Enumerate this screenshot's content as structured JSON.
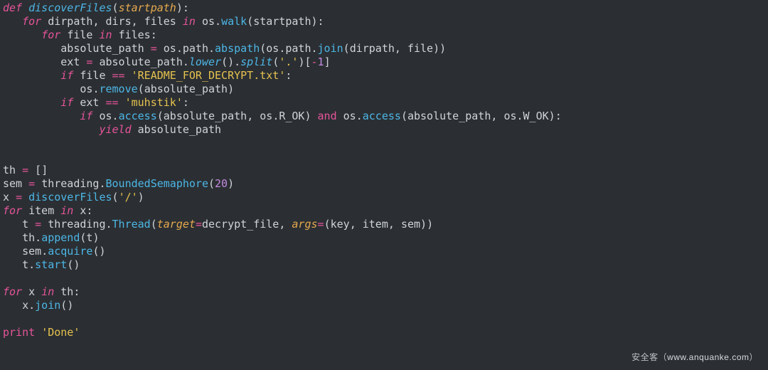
{
  "watermark": {
    "brand": "安全客",
    "site_open": "（",
    "site": "www.anquanke.com",
    "site_close": "）"
  },
  "code": {
    "kw_def": "def",
    "kw_for": "for",
    "kw_in": "in",
    "kw_if": "if",
    "kw_yield": "yield",
    "kw_and": "and",
    "kw_print": "print",
    "fn_discoverFiles": "discoverFiles",
    "var_startpath": "startpath",
    "var_dirpath": "dirpath",
    "var_dirs": "dirs",
    "var_files": "files",
    "var_file": "file",
    "var_absolute_path": "absolute_path",
    "var_ext": "ext",
    "var_th": "th",
    "var_sem": "sem",
    "var_x": "x",
    "var_item": "item",
    "var_t": "t",
    "var_key": "key",
    "var_os": "os",
    "var_threading": "threading",
    "var_decrypt_file": "decrypt_file",
    "attr_walk": "walk",
    "attr_path": "path",
    "attr_abspath": "abspath",
    "attr_join": "join",
    "attr_lower": "lower",
    "attr_split": "split",
    "attr_remove": "remove",
    "attr_access": "access",
    "attr_R_OK": "R_OK",
    "attr_W_OK": "W_OK",
    "attr_BoundedSemaphore": "BoundedSemaphore",
    "attr_Thread": "Thread",
    "attr_append": "append",
    "attr_acquire": "acquire",
    "attr_start": "start",
    "attr_join2": "join",
    "kw_target": "target",
    "kw_args": "args",
    "str_readme": "'README_FOR_DECRYPT.txt'",
    "str_muhstik": "'muhstik'",
    "str_dot": "'.'",
    "str_slash": "'/'",
    "str_done": "'Done'",
    "num_neg1": "1",
    "num_20": "20",
    "punct_lparen": "(",
    "punct_rparen": ")",
    "punct_colon": ":",
    "punct_dot": ".",
    "punct_comma": ",",
    "punct_lbr": "[",
    "punct_rbr": "]",
    "op_eq": "=",
    "op_eqeq": "==",
    "op_minus": "-",
    "indent1": "   ",
    "indent2": "      ",
    "indent3": "         ",
    "indent4": "            ",
    "indent5": "               "
  }
}
